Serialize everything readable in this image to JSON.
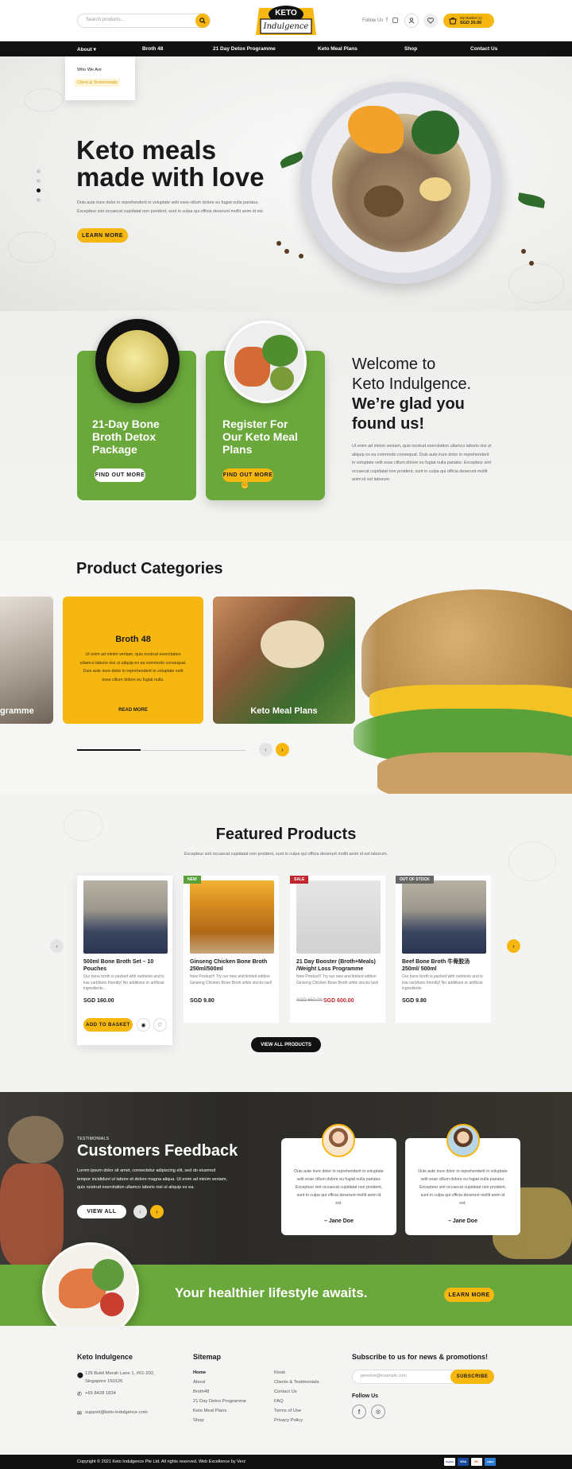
{
  "header": {
    "search_placeholder": "Search products...",
    "logo_top": "KETO",
    "logo_bottom": "Indulgence",
    "follow_label": "Follow Us",
    "basket_label": "My Basket (1)",
    "basket_amount": "SGD 20.00"
  },
  "nav": {
    "items": [
      "About",
      "Broth 48",
      "21 Day Detox Programme",
      "Keto Meal Plans",
      "Shop",
      "Contact Us"
    ],
    "dropdown": [
      "Who We Are",
      "Client & Testimonials"
    ]
  },
  "hero": {
    "title_line1": "Keto meals",
    "title_line2": "made with love",
    "text_line1": "Duis aute irure dolor in reprehenderit in voluptate velit esse cillum dolore eu fugiat nulla pariatur.",
    "text_line2": "Excepteur sint occaecat cupidatat non proident, sunt in culpa qui officia deserunt mollit anim id est.",
    "cta": "LEARN MORE"
  },
  "promo_cards": [
    {
      "title": "21-Day Bone Broth Detox Package",
      "cta": "FIND OUT MORE"
    },
    {
      "title": "Register For Our Keto Meal Plans",
      "cta": "FIND OUT MORE"
    }
  ],
  "welcome": {
    "line1": "Welcome to",
    "line2": "Keto Indulgence.",
    "line3": "We’re glad you",
    "line4": "found us!",
    "body": "Ut enim ad minim veniam, quis nostrud exercitation ullamco laboris nisi ut aliquip ex ea commodo consequat. Duis aute irure dolor in reprehenderit in voluptate velit esse cillum dolore eu fugiat nulla pariatur. Excepteur sint occaecat cupidatat non proident, sunt in culpa qui officia deserunt mollit anim id est laborum."
  },
  "categories": {
    "heading": "Product Categories",
    "left_partial": "gramme",
    "center_title": "Broth 48",
    "center_text": "Ut enim ad minim veniam, quis nostrud exercitation ullamco laboris nisi ut aliquip ex ea commodo consequat. Duis aute irure dolor in reprehenderit in voluptate velit esse cillum dolore eu fugiat nulla.",
    "center_cta": "READ MORE",
    "right_title": "Keto Meal Plans"
  },
  "featured": {
    "heading": "Featured Products",
    "subtitle": "Excepteur sint occaecat cupidatat non proident, sunt in culpa qui officia deserunt mollit anim id est laborum.",
    "view_all": "VIEW ALL PRODUCTS",
    "add_to_basket": "ADD TO BASKET",
    "products": [
      {
        "title": "500ml Bone Broth Set – 10 Pouches",
        "desc": "Our bone broth is packed with nutrients and is low carb/keto friendly! No additives or artificial ingredients...",
        "price": "SGD 160.00",
        "badge": "",
        "old_price": ""
      },
      {
        "title": "Ginseng Chicken Bone Broth 250ml/500ml",
        "desc": "New Product!! Try our new and limited edition Ginseng Chicken Bone Broth while stocks last!",
        "price": "SGD 9.80",
        "badge": "NEW",
        "old_price": ""
      },
      {
        "title": "21 Day Booster (Broth+Meals) /Weight Loss Programme",
        "desc": "New Product!! Try our new and limited edition Ginseng Chicken Bone Broth while stocks last!",
        "price": "SGD 600.00",
        "badge": "SALE",
        "old_price": "SGD 650.00"
      },
      {
        "title": "Beef Bone Broth 牛骨胶汤 250ml/ 500ml",
        "desc": "Our bone broth is packed with nutrients and is low carb/keto friendly! No additives or artificial ingredients",
        "price": "SGD 9.80",
        "badge": "OUT OF STOCK",
        "old_price": ""
      }
    ]
  },
  "feedback": {
    "eyebrow": "TESTIMONIALS",
    "heading": "Customers Feedback",
    "text": "Lorem ipsum dolor sit amet, consectetur adipiscing elit, sed do eiusmod tempor incididunt ut labore et dolore magna aliqua. Ut enim ad minim veniam, quis nostrud exercitation ullamco laboris nisi ut aliquip ex ea.",
    "view_all": "VIEW ALL",
    "testimonials": [
      {
        "quote": "Duis aute irure dolor in reprehenderit in voluptate velit esse cillum dolore eu fugiat nulla pariatur. Excepteur sint occaecat cupidatat non proident, sunt in culpa qui officia deserunt mollit anim id est.",
        "name": "– Jane Doe"
      },
      {
        "quote": "Duis aute irure dolor in reprehenderit in voluptate velit esse cillum dolore eu fugiat nulla pariatur. Excepteur sint occaecat cupidatat non proident, sunt in culpa qui officia deserunt mollit anim id est.",
        "name": "– Jane Doe"
      }
    ]
  },
  "cta_band": {
    "text": "Your healthier lifestyle awaits.",
    "button": "LEARN MORE"
  },
  "footer": {
    "brand": "Keto Indulgence",
    "address_line1": "126 Bukit Merah Lane 1, #01-202,",
    "address_line2": "Singapore 150126",
    "phone": "+65 8428 1834",
    "email": "support@keto-indulgence.com",
    "sitemap_heading": "Sitemap",
    "sitemap_col1": [
      "Home",
      "About",
      "Broth48",
      "21 Day Detox Programme",
      "Keto Meal Plans",
      "Shop"
    ],
    "sitemap_col2": [
      "Kiosk",
      "Clients & Testimonials",
      "Contact Us",
      "FAQ",
      "Terms of Use",
      "Privacy Policy"
    ],
    "subscribe_heading": "Subscribe to us for news & promotions!",
    "subscribe_placeholder": "janedoe@example.com",
    "subscribe_button": "SUBSCRIBE",
    "follow_heading": "Follow Us",
    "copyright": "Copyright © 2021 Keto Indulgence Pte Ltd. All rights reserved. Web Excellence by Verz",
    "payments": [
      "PayPal",
      "VISA",
      "MC",
      "AMEX"
    ]
  },
  "colors": {
    "accent": "#f5b710",
    "green": "#6aa83b",
    "dark": "#111111"
  }
}
